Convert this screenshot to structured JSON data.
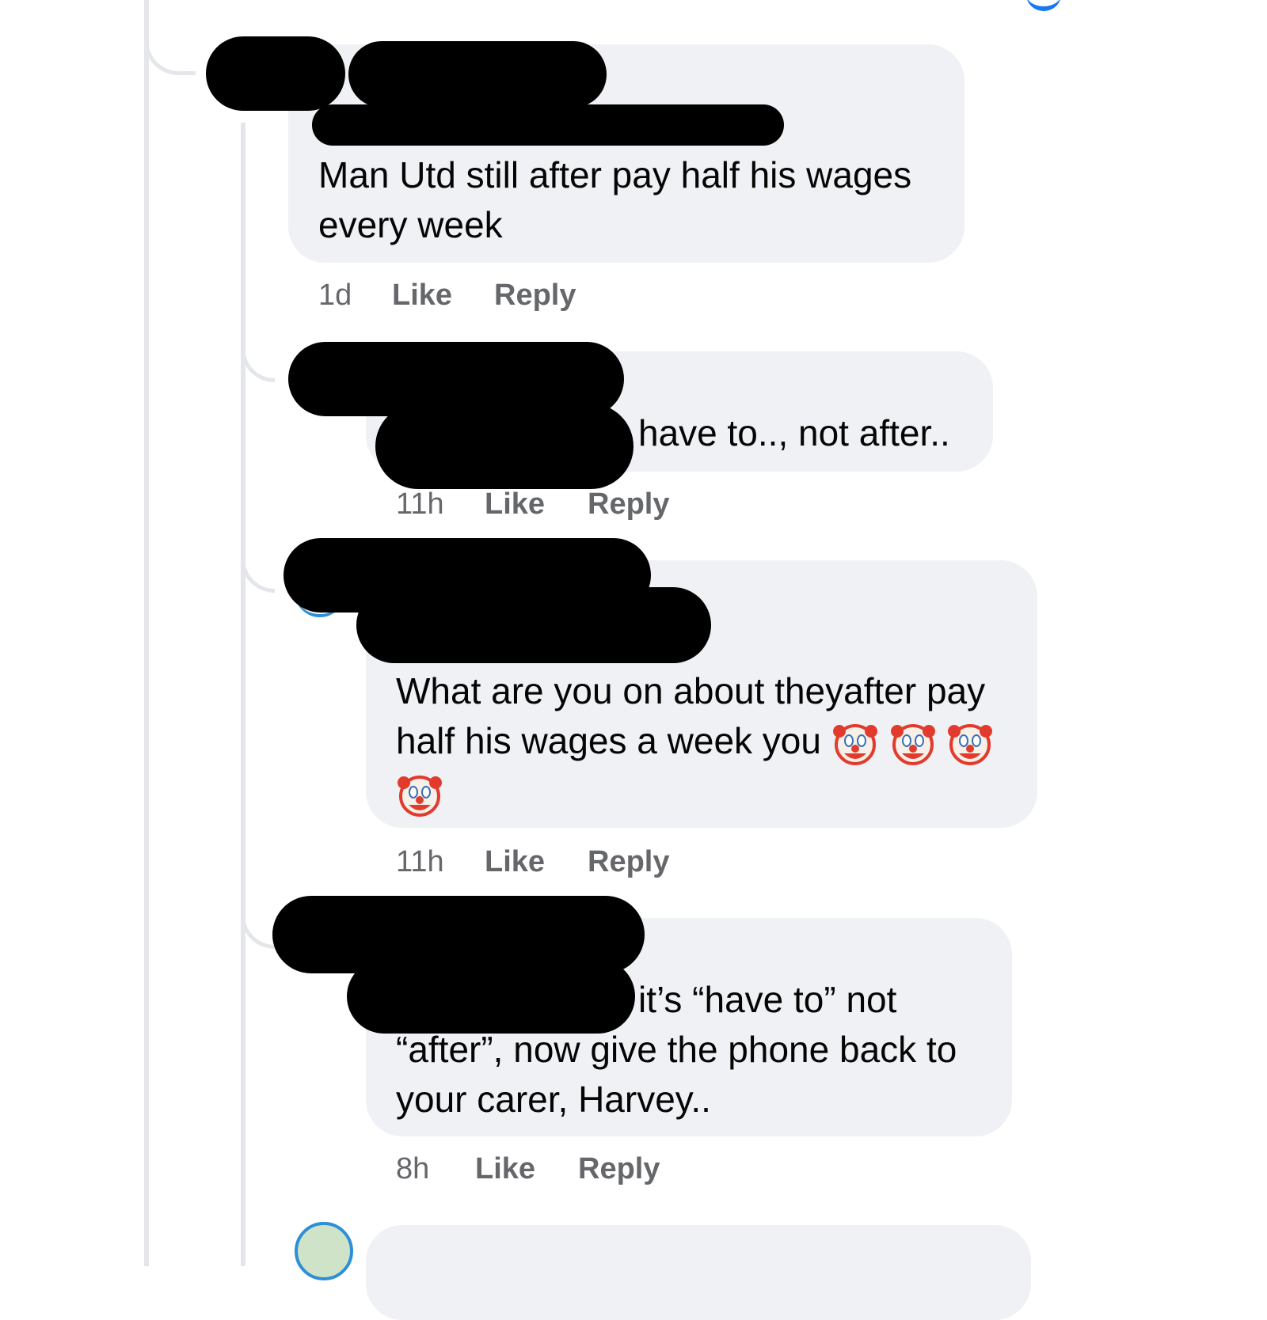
{
  "comments": [
    {
      "text": "Man Utd still after pay half his wages every week",
      "time": "1d",
      "like_label": "Like",
      "reply_label": "Reply"
    },
    {
      "text": "have to.., not after..",
      "time": "11h",
      "like_label": "Like",
      "reply_label": "Reply"
    },
    {
      "text": "What are you on about theyafter pay half his wages a week you",
      "emoji": [
        "clown-face",
        "clown-face",
        "clown-face",
        "clown-face"
      ],
      "time": "11h",
      "like_label": "Like",
      "reply_label": "Reply"
    },
    {
      "text_line1": "it’s “have to” not",
      "text_rest": "“after”, now give the phone back to your carer, Harvey..",
      "time": "8h",
      "like_label": "Like",
      "reply_label": "Reply"
    }
  ],
  "colors": {
    "bubble": "#f0f1f4",
    "meta_text": "#65676b",
    "thread_line": "#e4e6ea",
    "redaction": "#000000",
    "accent": "#1877f2"
  }
}
